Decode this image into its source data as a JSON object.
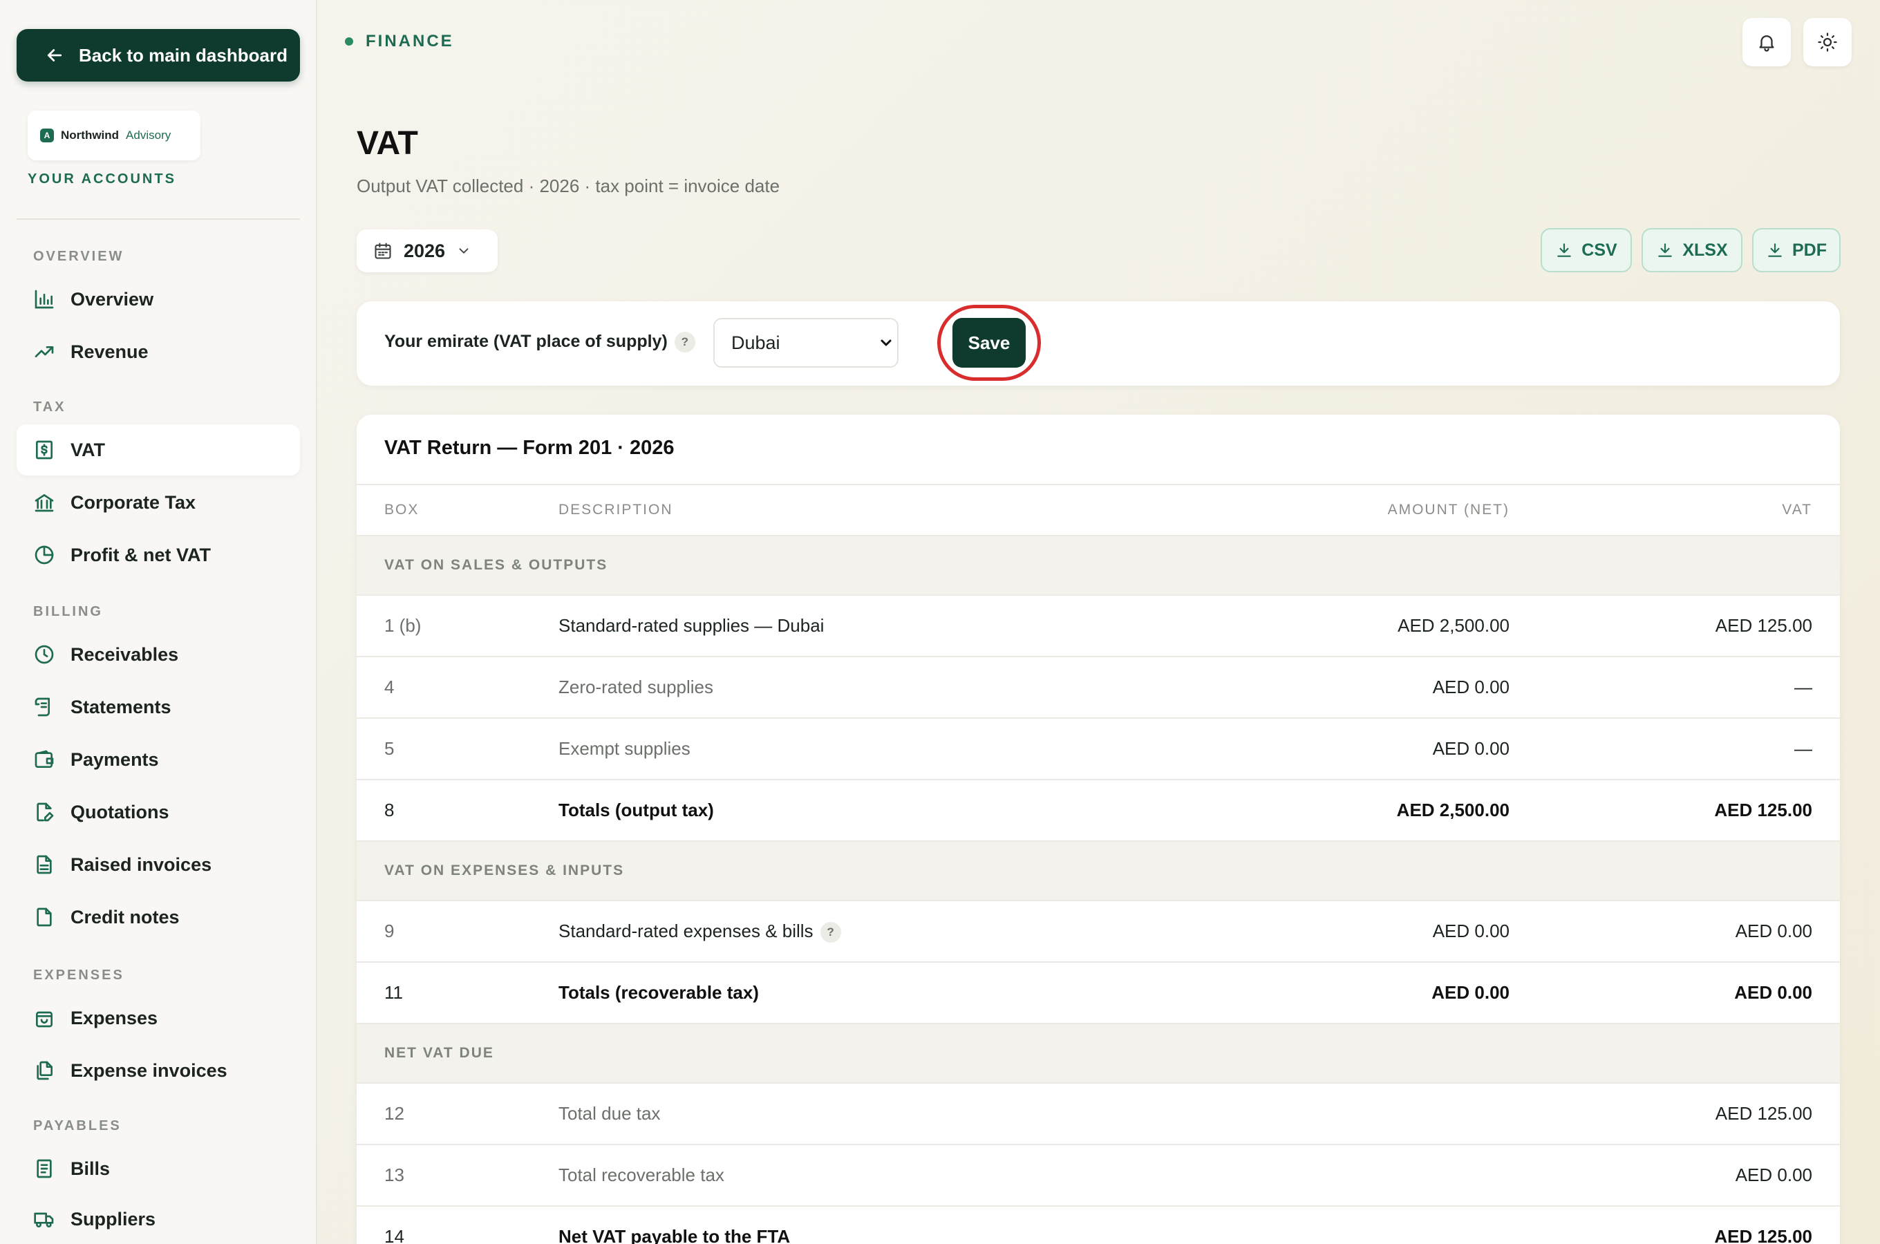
{
  "sidebar": {
    "back_label": "Back to main dashboard",
    "logo": {
      "mark": "A",
      "name": "Northwind",
      "sub": "Advisory"
    },
    "accounts_label": "YOUR ACCOUNTS",
    "sections": {
      "overview": "OVERVIEW",
      "tax": "TAX",
      "billing": "BILLING",
      "expenses": "EXPENSES",
      "payables": "PAYABLES"
    },
    "items": {
      "overview": "Overview",
      "revenue": "Revenue",
      "vat": "VAT",
      "corporate_tax": "Corporate Tax",
      "profit_net_vat": "Profit & net VAT",
      "receivables": "Receivables",
      "statements": "Statements",
      "payments": "Payments",
      "quotations": "Quotations",
      "raised_invoices": "Raised invoices",
      "credit_notes": "Credit notes",
      "expenses": "Expenses",
      "expense_invoices": "Expense invoices",
      "bills": "Bills",
      "suppliers": "Suppliers"
    },
    "active": "vat"
  },
  "header": {
    "breadcrumb": "FINANCE",
    "icons": [
      "bell-icon",
      "sun-icon"
    ]
  },
  "page": {
    "title": "VAT",
    "subtitle": "Output VAT collected · 2026 · tax point = invoice date",
    "year": "2026",
    "exports": [
      "CSV",
      "XLSX",
      "PDF"
    ]
  },
  "emirate": {
    "label": "Your emirate (VAT place of supply)",
    "help": "?",
    "selected": "Dubai",
    "save_label": "Save"
  },
  "table": {
    "title": "VAT Return — Form 201 · 2026",
    "columns": {
      "box": "BOX",
      "description": "DESCRIPTION",
      "amount": "AMOUNT (NET)",
      "vat": "VAT"
    },
    "sections": [
      {
        "name": "VAT ON SALES & OUTPUTS",
        "rows": [
          {
            "box": "1 (b)",
            "description": "Standard-rated supplies — Dubai",
            "amount": "AED 2,500.00",
            "vat": "AED 125.00",
            "style": "primary"
          },
          {
            "box": "4",
            "description": "Zero-rated supplies",
            "amount": "AED 0.00",
            "vat": "—",
            "style": "muted"
          },
          {
            "box": "5",
            "description": "Exempt supplies",
            "amount": "AED 0.00",
            "vat": "—",
            "style": "muted"
          },
          {
            "box": "8",
            "description": "Totals (output tax)",
            "amount": "AED 2,500.00",
            "vat": "AED 125.00",
            "style": "total"
          }
        ]
      },
      {
        "name": "VAT ON EXPENSES & INPUTS",
        "rows": [
          {
            "box": "9",
            "description": "Standard-rated expenses & bills",
            "amount": "AED 0.00",
            "vat": "AED 0.00",
            "style": "primary",
            "help": "?"
          },
          {
            "box": "11",
            "description": "Totals (recoverable tax)",
            "amount": "AED 0.00",
            "vat": "AED 0.00",
            "style": "total"
          }
        ]
      },
      {
        "name": "NET VAT DUE",
        "rows": [
          {
            "box": "12",
            "description": "Total due tax",
            "amount": "",
            "vat": "AED 125.00",
            "style": "muted"
          },
          {
            "box": "13",
            "description": "Total recoverable tax",
            "amount": "",
            "vat": "AED 0.00",
            "style": "muted"
          },
          {
            "box": "14",
            "description": "Net VAT payable to the FTA",
            "amount": "",
            "vat": "AED 125.00",
            "style": "total"
          }
        ]
      }
    ]
  },
  "colors": {
    "accent": "#0f3b2e",
    "brand": "#1d6b52",
    "highlight_ring": "#d92c2c"
  }
}
